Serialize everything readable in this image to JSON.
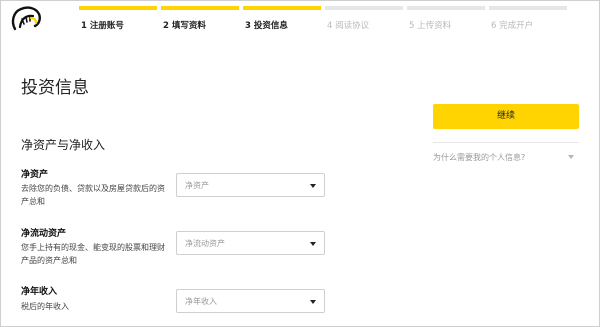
{
  "steps": [
    {
      "label": "1 注册账号",
      "done": true
    },
    {
      "label": "2 填写资料",
      "done": true
    },
    {
      "label": "3 投资信息",
      "done": true
    },
    {
      "label": "4 阅读协议",
      "done": false
    },
    {
      "label": "5 上传资料",
      "done": false
    },
    {
      "label": "6 完成开户",
      "done": false
    }
  ],
  "page_title": "投资信息",
  "section_title": "净资产与净收入",
  "fields": [
    {
      "label": "净资产",
      "desc": "去除您的负债、贷款以及房屋贷款后的资产总和",
      "placeholder": "净资产"
    },
    {
      "label": "净流动资产",
      "desc": "您手上持有的现金、能变现的股票和理财产品的资产总和",
      "placeholder": "净流动资产"
    },
    {
      "label": "净年收入",
      "desc": "税后的年收入",
      "placeholder": "净年收入"
    }
  ],
  "sidebar": {
    "continue_label": "继续",
    "why_label": "为什么需要我的个人信息?"
  },
  "colors": {
    "accent": "#ffd400",
    "inactive": "#e6e6e6"
  },
  "icons": {
    "logo": "brand-logo-icon",
    "select_caret": "caret-down-icon",
    "expand_caret": "chevron-down-icon"
  }
}
